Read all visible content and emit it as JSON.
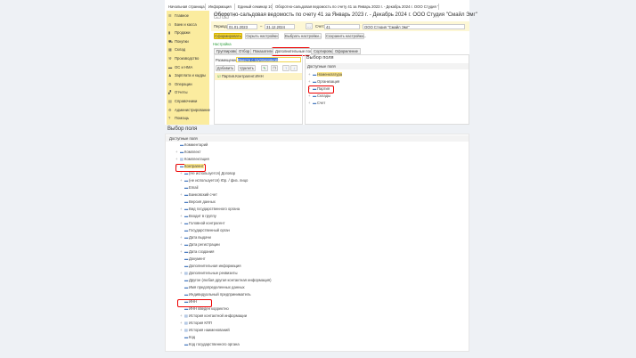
{
  "tabs": [
    "Начальная страница",
    "Информация",
    "Единый семинар 1С",
    "Оборотно-сальдовая ведомость по счету 41 за Январь 2023 г. - Декабрь 2024 г. ООО Студия \"Смайл Эмг\""
  ],
  "sidebar": [
    "Главное",
    "Банк и касса",
    "Продажи",
    "Покупки",
    "Склад",
    "Производство",
    "ОС и НМА",
    "Зарплата и кадры",
    "Операции",
    "Отчеты",
    "Справочники",
    "Администрирование",
    "Помощь"
  ],
  "title": "Оборотно-сальдовая ведомость по счету 41 за Январь 2023 г. - Декабрь 2024 г. ООО Студия \"Смайл Эмг\"",
  "filters": {
    "period_label": "Период:",
    "date_from": "01.01.2023",
    "dash": "–",
    "date_to": "31.12.2024",
    "account_label": "Счет:",
    "account": "41",
    "org": "ООО Студия \"Смайл Эмг\""
  },
  "buttons": {
    "generate": "Сформировать",
    "hide": "Скрыть настройки",
    "choose": "Выбрать настройки...",
    "save": "Сохранить настройки..."
  },
  "settings_link": "Настройка",
  "settings_tabs": [
    "Группировка",
    "Отбор",
    "Показатели",
    "Дополнительные поля",
    "Сортировка",
    "Оформление"
  ],
  "left_panel": {
    "placement_label": "Размещение:",
    "placement_value": "Вместе с группировкой",
    "add": "Добавить",
    "delete": "Удалить",
    "item": "Партия.Контрагент.ИНН"
  },
  "right_panel": {
    "title": "Выбор поля",
    "header": "Доступные поля",
    "items": [
      "Номенклатура",
      "Организация",
      "Партия",
      "Склады",
      "Счет"
    ]
  },
  "bottom": {
    "title": "Выбор поля",
    "header": "Доступные поля",
    "items": [
      {
        "t": "Комментарий",
        "l": 1,
        "e": false
      },
      {
        "t": "Комплект",
        "l": 1,
        "e": true
      },
      {
        "t": "Комплектация",
        "l": 1,
        "e": true,
        "tbl": true
      },
      {
        "t": "Контрагент",
        "l": 1,
        "e": true
      },
      {
        "t": "(Не используется) Договор",
        "l": 2,
        "e": true
      },
      {
        "t": "(не используется) Юр. / физ. лицо",
        "l": 2,
        "e": true
      },
      {
        "t": "Email",
        "l": 2,
        "e": false
      },
      {
        "t": "Банковский счет",
        "l": 2,
        "e": true
      },
      {
        "t": "Версия данных",
        "l": 2,
        "e": false
      },
      {
        "t": "Вид государственного органа",
        "l": 2,
        "e": true
      },
      {
        "t": "Входит в группу",
        "l": 2,
        "e": true
      },
      {
        "t": "Головной контрагент",
        "l": 2,
        "e": true
      },
      {
        "t": "Государственный орган",
        "l": 2,
        "e": false
      },
      {
        "t": "Дата выдачи",
        "l": 2,
        "e": true
      },
      {
        "t": "Дата регистрации",
        "l": 2,
        "e": true
      },
      {
        "t": "Дата создания",
        "l": 2,
        "e": true
      },
      {
        "t": "Документ",
        "l": 2,
        "e": false
      },
      {
        "t": "Дополнительная информация",
        "l": 2,
        "e": false
      },
      {
        "t": "Дополнительные реквизиты",
        "l": 2,
        "e": true,
        "tbl": true
      },
      {
        "t": "Другое (любая другая контактная информация)",
        "l": 2,
        "e": false
      },
      {
        "t": "Имя предопределенных данных",
        "l": 2,
        "e": false
      },
      {
        "t": "Индивидуальный предприниматель",
        "l": 2,
        "e": false
      },
      {
        "t": "ИНН",
        "l": 2,
        "e": false
      },
      {
        "t": "ИНН введен корректно",
        "l": 2,
        "e": false
      },
      {
        "t": "История контактной информации",
        "l": 2,
        "e": true,
        "tbl": true
      },
      {
        "t": "История КПП",
        "l": 2,
        "e": true,
        "tbl": true
      },
      {
        "t": "История наименований",
        "l": 2,
        "e": true,
        "tbl": true
      },
      {
        "t": "Код",
        "l": 2,
        "e": false
      },
      {
        "t": "Код государственного органа",
        "l": 2,
        "e": false
      }
    ]
  },
  "colors": {
    "accent": "#fbec9f",
    "highlight": "#e00000",
    "button": "#f5d52d"
  }
}
